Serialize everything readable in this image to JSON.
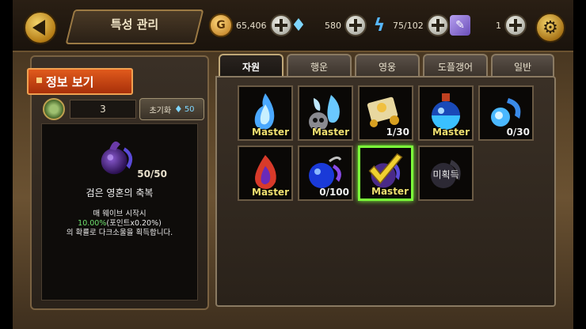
{
  "header": {
    "title": "특성 관리"
  },
  "resources": {
    "gold": "65,406",
    "gems": "580",
    "energy": "75/102",
    "tickets": "1"
  },
  "info_panel": {
    "title": "정보 보기",
    "level": "3",
    "reset_label": "초기화",
    "reset_cost": "50",
    "detail": {
      "icon": "dark-soul-orb-icon",
      "progress": "50/50",
      "name": "검은 영혼의 축복",
      "desc_line1": "매 웨이브 시작시",
      "desc_highlight": "10.00%",
      "desc_line2_rest": "(포인트x0.20%)",
      "desc_line3": "의 확률로 다크소울을 획득합니다."
    }
  },
  "tabs": [
    {
      "label": "자원",
      "active": true
    },
    {
      "label": "행운",
      "active": false
    },
    {
      "label": "영웅",
      "active": false
    },
    {
      "label": "도플갱어",
      "active": false
    },
    {
      "label": "일반",
      "active": false
    }
  ],
  "skills": [
    {
      "icon": "blue-soul-flame-icon",
      "label": "Master"
    },
    {
      "icon": "soul-skull-icon",
      "label": "Master"
    },
    {
      "icon": "gold-book-icon",
      "label": "1/30"
    },
    {
      "icon": "blue-potion-icon",
      "label": "Master"
    },
    {
      "icon": "soul-wisp-icon",
      "label": "0/30"
    },
    {
      "icon": "red-purple-soul-icon",
      "label": "Master"
    },
    {
      "icon": "blue-bomb-icon",
      "label": "0/100"
    },
    {
      "icon": "dark-soul-check-icon",
      "label": "Master",
      "selected": true
    },
    {
      "icon": "locked-soul-icon",
      "label": "미획득"
    }
  ],
  "colors": {
    "accent": "#e05a1c",
    "selected": "#7cff3a",
    "master_text": "#f0e070",
    "highlight": "#6ee06e"
  }
}
